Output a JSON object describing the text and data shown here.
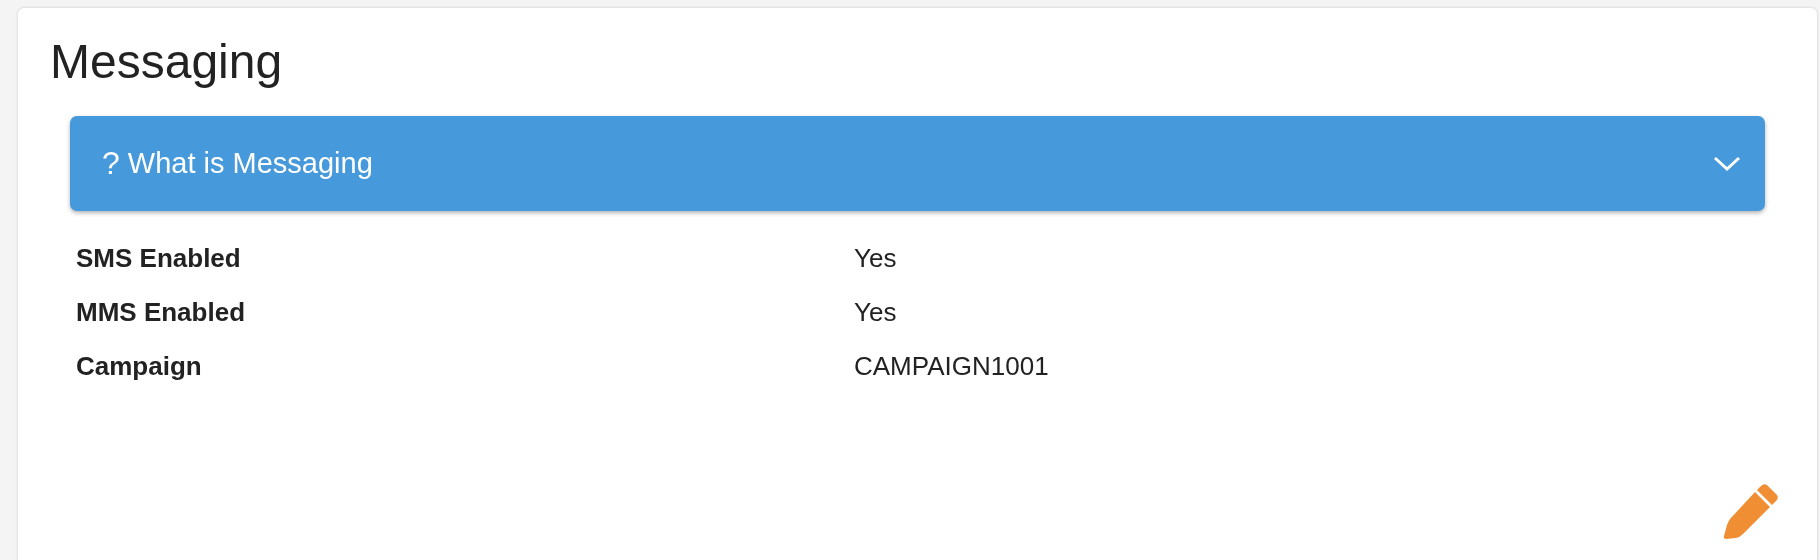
{
  "title": "Messaging",
  "help_panel": {
    "icon": "?",
    "label": "What is Messaging",
    "expanded": false
  },
  "fields": [
    {
      "label": "SMS Enabled",
      "value": "Yes"
    },
    {
      "label": "MMS Enabled",
      "value": "Yes"
    },
    {
      "label": "Campaign",
      "value": "CAMPAIGN1001"
    }
  ]
}
